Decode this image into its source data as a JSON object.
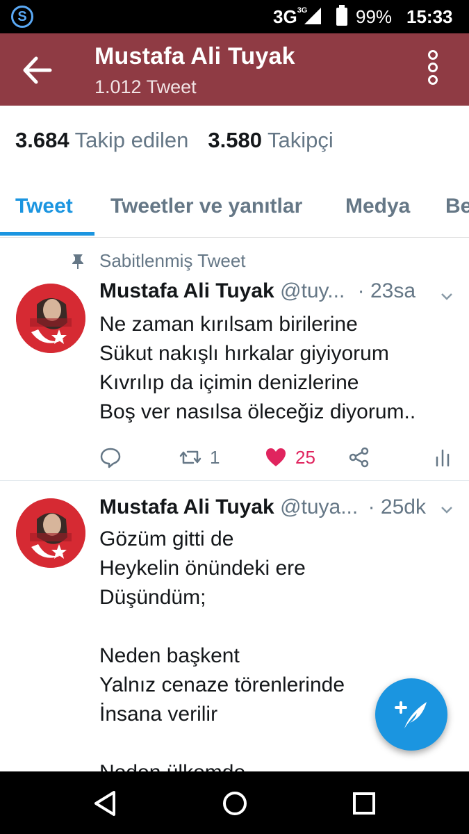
{
  "status_bar": {
    "app_icon": "S",
    "network": "3G",
    "network_sup": "3G",
    "battery": "99%",
    "time": "15:33"
  },
  "header": {
    "name": "Mustafa Ali Tuyak",
    "tweet_count": "1.012 Tweet"
  },
  "stats": {
    "following_count": "3.684",
    "following_label": "Takip edilen",
    "followers_count": "3.580",
    "followers_label": "Takipçi"
  },
  "tabs": [
    "Tweet",
    "Tweetler ve yanıtlar",
    "Medya",
    "Be"
  ],
  "pinned_label": "Sabitlenmiş Tweet",
  "tweets": [
    {
      "name": "Mustafa Ali Tuyak",
      "handle": "@tuy...",
      "time": "· 23sa",
      "text": "Ne zaman kırılsam birilerine\nSükut nakışlı hırkalar giyiyorum\nKıvrılıp da içimin denizlerine\nBoş ver nasılsa öleceğiz diyorum..",
      "retweets": "1",
      "likes": "25"
    },
    {
      "name": "Mustafa Ali Tuyak",
      "handle": "@tuya...",
      "time": "· 25dk",
      "text": "Gözüm gitti de\nHeykelin önündeki ere\nDüşündüm;\n\nNeden başkent\nYalnız cenaze törenlerinde\nİnsana verilir\n\nNeden ülkemde"
    }
  ],
  "colors": {
    "header_bg": "#8f3b44",
    "accent": "#1b95e0",
    "like_red": "#e0245e"
  }
}
